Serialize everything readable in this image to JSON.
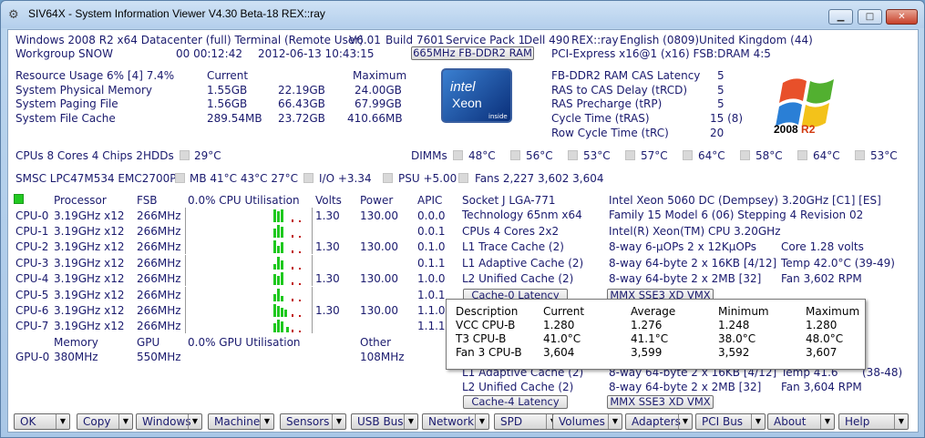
{
  "window": {
    "title": "SIV64X - System Information Viewer V4.30 Beta-18 REX::ray",
    "min": "▁",
    "max": "□",
    "close": "✕"
  },
  "header": {
    "os_line": "Windows 2008 R2 x64 Datacenter (full) Terminal (Remote User)",
    "version": "V6.01",
    "build": "Build 7601",
    "sp": "Service Pack 1",
    "machine": "Dell 490",
    "user": "REX::ray",
    "lang": "English (0809)",
    "country": "United Kingdom (44)",
    "workgroup": "Workgroup SNOW",
    "uptime": "00 00:12:42",
    "datetime": "2012-06-13 10:43:15",
    "mem_button": "665MHz FB-DDR2 RAM",
    "pci": "PCI-Express x16@1 (x16) FSB:DRAM 4:5"
  },
  "resources": {
    "label": "Resource Usage 6% [4] 7.4%",
    "col_current": "Current",
    "col_maximum": "Maximum",
    "rows": [
      {
        "label": "System Physical Memory",
        "current": "1.55GB",
        "mid": "22.19GB",
        "max": "24.00GB"
      },
      {
        "label": "System Paging File",
        "current": "1.56GB",
        "mid": "66.43GB",
        "max": "67.99GB"
      },
      {
        "label": "System File Cache",
        "current": "289.54MB",
        "mid": "23.72GB",
        "max": "410.66MB"
      }
    ]
  },
  "ram_timings": [
    {
      "label": "FB-DDR2 RAM CAS Latency",
      "value": "5"
    },
    {
      "label": "RAS to CAS Delay (tRCD)",
      "value": "5"
    },
    {
      "label": "RAS Precharge (tRP)",
      "value": "5"
    },
    {
      "label": "Cycle Time (tRAS)",
      "value": "15 (8)"
    },
    {
      "label": "Row Cycle Time (tRC)",
      "value": "20"
    }
  ],
  "logos": {
    "intel": "intel",
    "xeon": "Xeon",
    "inside": "inside",
    "win_year": "2008",
    "win_r2": "R2"
  },
  "summary": {
    "cpus": "CPUs 8 Cores 4 Chips 2",
    "hdds_label": "HDDs",
    "hdds_temp": "29°C",
    "dimms_label": "DIMMs",
    "dimm_temps": [
      "48°C",
      "56°C",
      "53°C",
      "57°C",
      "64°C",
      "58°C",
      "64°C",
      "53°C"
    ],
    "smsc": "SMSC LPC47M534 EMC2700P",
    "mb": "MB 41°C 43°C 27°C",
    "io": "I/O +3.34",
    "psu": "PSU +5.00",
    "fans": "Fans 2,227 3,602 3,604"
  },
  "cpu_table": {
    "headers": {
      "processor": "Processor",
      "fsb": "FSB",
      "util": "0.0% CPU Utilisation",
      "volts": "Volts",
      "power": "Power",
      "apic": "APIC"
    },
    "rows": [
      {
        "name": "CPU-0",
        "clock": "3.19GHz x12",
        "fsb": "266MHz",
        "volts": "1.30",
        "power": "130.00",
        "apic": "0.0.0"
      },
      {
        "name": "CPU-1",
        "clock": "3.19GHz x12",
        "fsb": "266MHz",
        "volts": "",
        "power": "",
        "apic": "0.0.1"
      },
      {
        "name": "CPU-2",
        "clock": "3.19GHz x12",
        "fsb": "266MHz",
        "volts": "1.30",
        "power": "130.00",
        "apic": "0.1.0"
      },
      {
        "name": "CPU-3",
        "clock": "3.19GHz x12",
        "fsb": "266MHz",
        "volts": "",
        "power": "",
        "apic": "0.1.1"
      },
      {
        "name": "CPU-4",
        "clock": "3.19GHz x12",
        "fsb": "266MHz",
        "volts": "1.30",
        "power": "130.00",
        "apic": "1.0.0"
      },
      {
        "name": "CPU-5",
        "clock": "3.19GHz x12",
        "fsb": "266MHz",
        "volts": "",
        "power": "",
        "apic": "1.0.1"
      },
      {
        "name": "CPU-6",
        "clock": "3.19GHz x12",
        "fsb": "266MHz",
        "volts": "1.30",
        "power": "130.00",
        "apic": "1.1.0"
      },
      {
        "name": "CPU-7",
        "clock": "3.19GHz x12",
        "fsb": "266MHz",
        "volts": "",
        "power": "",
        "apic": "1.1.1"
      }
    ],
    "gpu_headers": {
      "memory": "Memory",
      "gpu": "GPU",
      "util": "0.0% GPU Utilisation",
      "other": "Other"
    },
    "gpu_row": {
      "name": "GPU-0",
      "memory": "380MHz",
      "gpu": "550MHz",
      "other": "108MHz"
    }
  },
  "cpu_details": {
    "socket": "Socket J LGA-771",
    "technology": "Technology 65nm  x64",
    "cpus": "CPUs 4 Cores 2x2",
    "l1_trace": "L1 Trace Cache (2)",
    "l1_adaptive": "L1 Adaptive Cache (2)",
    "l2_unified": "L2 Unified Cache (2)",
    "cache0_button": "Cache-0 Latency",
    "model": "Intel Xeon 5060 DC (Dempsey) 3.20GHz [C1] [ES]",
    "family": "Family 15  Model 6 (06)  Stepping 4  Revision 02",
    "brand": "Intel(R) Xeon(TM) CPU 3.20GHz",
    "trace_way": "8-way  6-μOPs  2 x 12KμOPs",
    "adaptive_way": "8-way 64-byte  2 x 16KB [4/12]",
    "unified_way": "8-way 64-byte  2 x 2MB  [32]",
    "core_volts": "Core 1.28 volts",
    "temp": "Temp 42.0°C (39-49)",
    "fan": "Fan  3,602 RPM",
    "flags_button": "MMX SSE3 XD VMX",
    "l1_adaptive_b": "L1 Adaptive Cache (2)",
    "l2_unified_b": "L2 Unified Cache (2)",
    "cache4_button": "Cache-4 Latency",
    "adaptive_way_b": "8-way 64-byte  2 x 16KB [4/12]",
    "unified_way_b": "8-way 64-byte  2 x 2MB  [32]",
    "temp_b": "Temp 41.6",
    "temp_b_range": "(38-48)",
    "fan_b": "Fan  3,604 RPM",
    "flags_button_b": "MMX SSE3 XD VMX"
  },
  "tooltip": {
    "headers": [
      "Description",
      "Current",
      "Average",
      "Minimum",
      "Maximum"
    ],
    "rows": [
      [
        "VCC CPU-B",
        "1.280",
        "1.276",
        "1.248",
        "1.280"
      ],
      [
        "T3 CPU-B",
        "41.0°C",
        "41.1°C",
        "38.0°C",
        "48.0°C"
      ],
      [
        "Fan 3 CPU-B",
        "3,604",
        "3,599",
        "3,592",
        "3,607"
      ]
    ]
  },
  "bottom_buttons": [
    "OK",
    "Copy",
    "Windows",
    "Machine",
    "Sensors",
    "USB Bus",
    "Network",
    "SPD",
    "Volumes",
    "Adapters",
    "PCI Bus",
    "About",
    "Help"
  ],
  "colors": {
    "text": "#1a1a6e",
    "graph_green": "#1ec81e",
    "graph_red": "#c01818",
    "chrome": "#a9c7e6"
  }
}
